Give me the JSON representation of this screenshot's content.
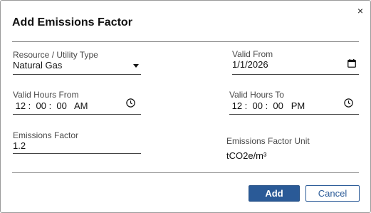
{
  "dialog": {
    "title": "Add Emissions Factor",
    "close_label": "×"
  },
  "form": {
    "resource_type": {
      "label": "Resource / Utility Type",
      "value": "Natural Gas"
    },
    "valid_from": {
      "label": "Valid From",
      "value": "1/1/2026"
    },
    "valid_hours_from": {
      "label": "Valid Hours From",
      "value": " 12 :  00 :  00   AM"
    },
    "valid_hours_to": {
      "label": "Valid Hours To",
      "value": " 12 :  00 :  00   PM"
    },
    "emissions_factor": {
      "label": "Emissions Factor",
      "value": "1.2"
    },
    "emissions_factor_unit": {
      "label": "Emissions Factor Unit",
      "value": "tCO2e/m³"
    }
  },
  "actions": {
    "add_label": "Add",
    "cancel_label": "Cancel"
  },
  "colors": {
    "primary": "#2a5a97",
    "divider": "#8a8a8a"
  }
}
